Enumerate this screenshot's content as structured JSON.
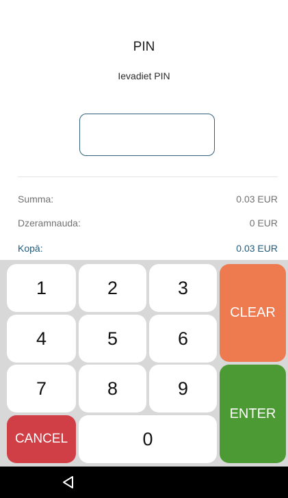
{
  "header": {
    "title": "PIN",
    "subtitle": "Ievadiet PIN"
  },
  "pin_field": {
    "value": ""
  },
  "summary": {
    "amount_label": "Summa:",
    "amount_value": "0.03 EUR",
    "tip_label": "Dzeramnauda:",
    "tip_value": "0 EUR",
    "total_label": "Kopā:",
    "total_value": "0.03 EUR"
  },
  "keypad": {
    "digits": {
      "k1": "1",
      "k2": "2",
      "k3": "3",
      "k4": "4",
      "k5": "5",
      "k6": "6",
      "k7": "7",
      "k8": "8",
      "k9": "9",
      "k0": "0"
    },
    "clear_label": "CLEAR",
    "enter_label": "ENTER",
    "cancel_label": "CANCEL"
  },
  "colors": {
    "clear": "#ee7a4f",
    "enter": "#4c9a34",
    "cancel": "#cf3f45",
    "accent": "#1f5a78"
  },
  "navbar": {
    "back_icon": "back-triangle-icon"
  }
}
